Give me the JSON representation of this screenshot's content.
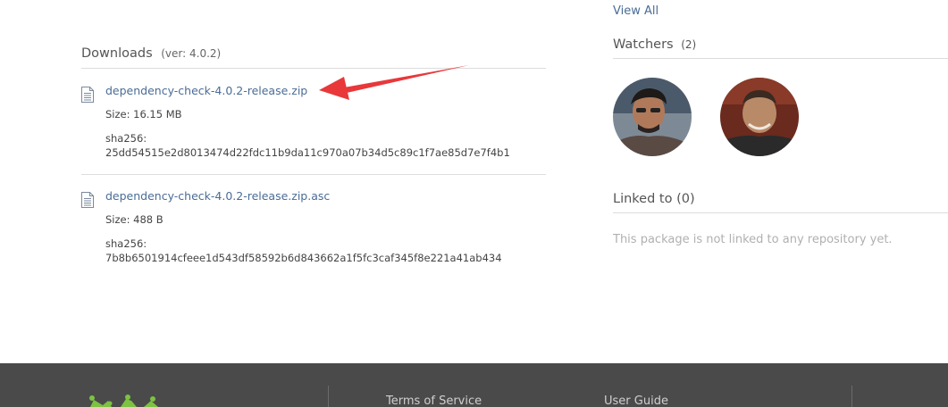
{
  "downloads": {
    "title": "Downloads",
    "version": "(ver: 4.0.2)",
    "files": [
      {
        "name": "dependency-check-4.0.2-release.zip",
        "size": "Size: 16.15 MB",
        "sha_label": "sha256:",
        "sha_value": "25dd54515e2d8013474d22fdc11b9da11c970a07b34d5c89c1f7ae85d7e7f4b1"
      },
      {
        "name": "dependency-check-4.0.2-release.zip.asc",
        "size": "Size: 488 B",
        "sha_label": "sha256:",
        "sha_value": "7b8b6501914cfeee1d543df58592b6d843662a1f5fc3caf345f8e221a41ab434"
      }
    ]
  },
  "sidebar": {
    "view_all": "View All",
    "watchers_title": "Watchers",
    "watchers_count": "(2)",
    "linked_title": "Linked to (0)",
    "not_linked": "This package is not linked to any repository yet."
  },
  "footer": {
    "links": [
      "Terms of Service",
      "User Guide"
    ]
  },
  "colors": {
    "link": "#4a6c96",
    "arrow": "#e8383a",
    "footer_bg": "#4a4a4a",
    "logo_green": "#7dc242"
  }
}
